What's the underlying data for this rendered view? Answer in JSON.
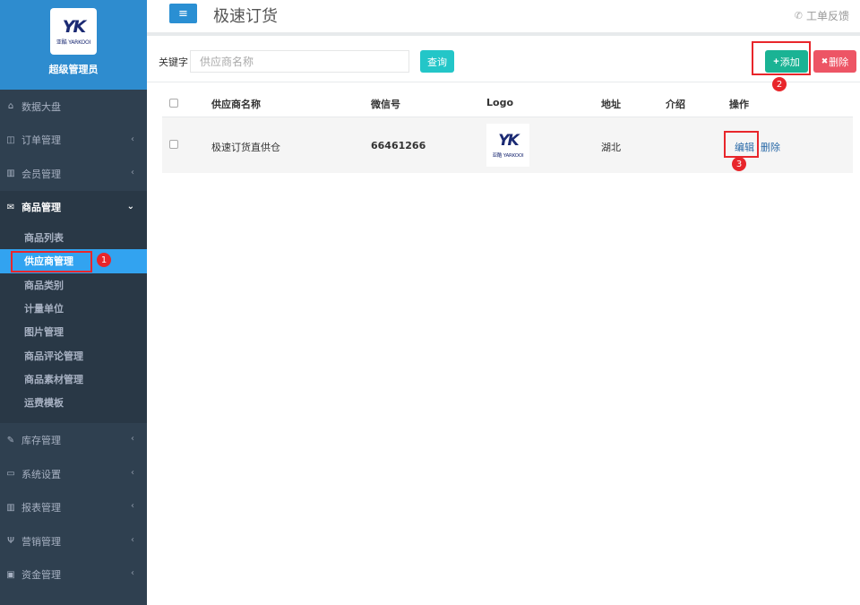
{
  "profile": {
    "logo_letters": "YK",
    "logo_sub": "亚酷 YARKOOI",
    "name": "超级管理员"
  },
  "sidebar": {
    "items": [
      {
        "label": "数据大盘",
        "icon": "home-icon"
      },
      {
        "label": "订单管理",
        "icon": "columns-icon"
      },
      {
        "label": "会员管理",
        "icon": "bar-chart-icon"
      },
      {
        "label": "商品管理",
        "icon": "envelope-icon"
      },
      {
        "label": "库存管理",
        "icon": "edit-icon"
      },
      {
        "label": "系统设置",
        "icon": "desktop-icon"
      },
      {
        "label": "报表管理",
        "icon": "bar-chart-icon"
      },
      {
        "label": "营销管理",
        "icon": "cutlery-icon"
      },
      {
        "label": "资金管理",
        "icon": "money-icon"
      }
    ],
    "submenu": [
      "商品列表",
      "供应商管理",
      "商品类别",
      "计量单位",
      "图片管理",
      "商品评论管理",
      "商品素材管理",
      "运费模板"
    ]
  },
  "header": {
    "title": "极速订货",
    "feedback": "工单反馈"
  },
  "filter": {
    "keyword_label": "关键字",
    "keyword_placeholder": "供应商名称",
    "query_label": "查询",
    "add_label": "添加",
    "delete_label": "删除"
  },
  "table": {
    "columns": [
      "供应商名称",
      "微信号",
      "Logo",
      "地址",
      "介绍",
      "操作"
    ],
    "rows": [
      {
        "name": "极速订货直供仓",
        "wechat": "66461266",
        "logo": "YK",
        "address": "湖北",
        "intro": "",
        "edit": "编辑",
        "delete": "删除"
      }
    ]
  },
  "badges": [
    "1",
    "2",
    "3"
  ],
  "colors": {
    "sidebar_bg": "#2f4050",
    "profile_bg": "#2e8ccf",
    "active_item": "#32a3f0",
    "query_btn": "#23c6c8",
    "add_btn": "#1ab394",
    "delete_btn": "#ed5565",
    "annotation_red": "#e8262b"
  }
}
